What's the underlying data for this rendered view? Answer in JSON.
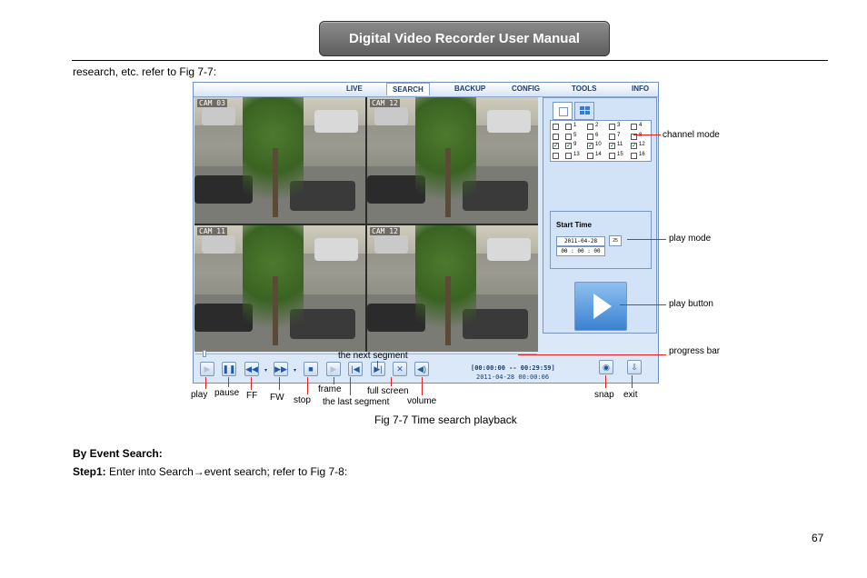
{
  "header": {
    "title": "Digital Video Recorder User Manual"
  },
  "intro_text": "research, etc. refer to Fig 7-7:",
  "figure": {
    "nav": [
      "LIVE",
      "SEARCH",
      "BACKUP",
      "CONFIG",
      "TOOLS",
      "INFO"
    ],
    "active_nav": "SEARCH",
    "cameras": [
      "CAM 03",
      "CAM 12",
      "CAM 11",
      "CAM 12"
    ],
    "channels": [
      [
        {
          "n": "1",
          "checked": false
        },
        {
          "n": "2",
          "checked": false
        },
        {
          "n": "3",
          "checked": false
        },
        {
          "n": "4",
          "checked": false
        }
      ],
      [
        {
          "n": "5",
          "checked": false
        },
        {
          "n": "6",
          "checked": false
        },
        {
          "n": "7",
          "checked": false
        },
        {
          "n": "8",
          "checked": false
        }
      ],
      [
        {
          "n": "9",
          "checked": true
        },
        {
          "n": "10",
          "checked": true
        },
        {
          "n": "11",
          "checked": true
        },
        {
          "n": "12",
          "checked": true
        }
      ],
      [
        {
          "n": "13",
          "checked": false
        },
        {
          "n": "14",
          "checked": false
        },
        {
          "n": "15",
          "checked": false
        },
        {
          "n": "16",
          "checked": false
        }
      ]
    ],
    "row_checked": [
      false,
      false,
      true,
      false
    ],
    "start_time_label": "Start Time",
    "date_value": "2011-04-28",
    "calendar_label": "25",
    "time_value": "00 : 00 : 00",
    "timecode_range": "[00:00:00 -- 00:29:59]",
    "timecode_now": "2011-04-28 00:00:06",
    "annotations": {
      "channel_mode": "channel mode",
      "play_mode": "play mode",
      "play_button": "play button",
      "progress_bar": "progress bar",
      "next_segment": "the next segment",
      "play": "play",
      "pause": "pause",
      "ff": "FF",
      "fw": "FW",
      "stop": "stop",
      "frame": "frame",
      "last_segment": "the last segment",
      "full_screen": "full screen",
      "volume": "volume",
      "snap": "snap",
      "exit": "exit"
    }
  },
  "caption": "Fig 7-7 Time search playback",
  "section_heading": "By Event Search:",
  "step1": {
    "label": "Step1:",
    "text_before": " Enter into Search",
    "arrow": "→",
    "text_after": "event search; refer to Fig 7-8:"
  },
  "page_number": "67"
}
